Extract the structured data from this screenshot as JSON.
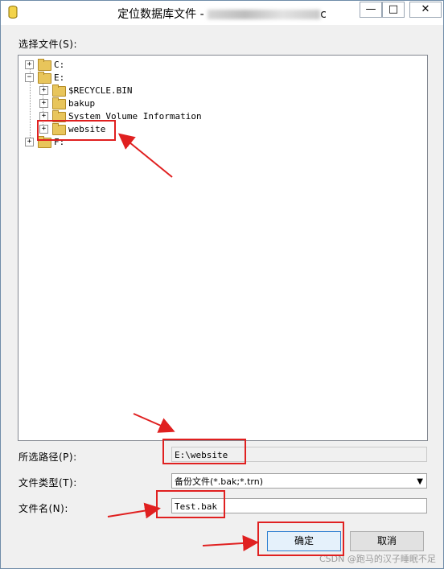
{
  "window": {
    "title_prefix": "定位数据库文件 - ",
    "title_suffix": "c",
    "min_glyph": "—",
    "max_glyph": "□",
    "close_glyph": "✕"
  },
  "labels": {
    "select_file": "选择文件(S):",
    "selected_path": "所选路径(P):",
    "file_type": "文件类型(T):",
    "file_name": "文件名(N):"
  },
  "tree": {
    "drive_c": "C:",
    "drive_e": "E:",
    "recycle": "$RECYCLE.BIN",
    "bakup": "bakup",
    "svi": "System Volume Information",
    "website": "website",
    "drive_f": "F:"
  },
  "fields": {
    "selected_path_value": "E:\\website",
    "file_type_value": "备份文件(*.bak;*.trn)",
    "file_name_value": "Test.bak"
  },
  "buttons": {
    "ok": "确定",
    "cancel": "取消"
  },
  "watermark": "CSDN @跑马的汉子睡眠不足",
  "colors": {
    "annotation": "#e02020",
    "folder": "#e8c55b"
  }
}
